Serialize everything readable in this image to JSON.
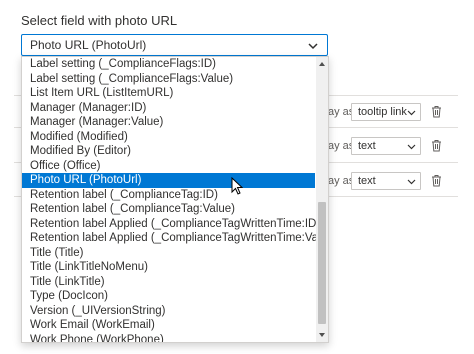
{
  "field": {
    "label": "Select field with photo URL",
    "selected_value": "Photo URL (PhotoUrl)"
  },
  "background_rows": [
    {
      "prefix": "ay as",
      "select_value": "tooltip link"
    },
    {
      "prefix": "ay as",
      "select_value": "text"
    },
    {
      "prefix": "ay as",
      "select_value": "text"
    }
  ],
  "dropdown": {
    "options": [
      "Label setting (_ComplianceFlags:ID)",
      "Label setting (_ComplianceFlags:Value)",
      "List Item URL (ListItemURL)",
      "Manager (Manager:ID)",
      "Manager (Manager:Value)",
      "Modified (Modified)",
      "Modified By (Editor)",
      "Office (Office)",
      "Photo URL (PhotoUrl)",
      "Retention label (_ComplianceTag:ID)",
      "Retention label (_ComplianceTag:Value)",
      "Retention label Applied (_ComplianceTagWrittenTime:ID)",
      "Retention label Applied (_ComplianceTagWrittenTime:Value)",
      "Title (Title)",
      "Title (LinkTitleNoMenu)",
      "Title (LinkTitle)",
      "Type (DocIcon)",
      "Version (_UIVersionString)",
      "Work Email (WorkEmail)",
      "Work Phone (WorkPhone)"
    ],
    "selected_index": 8
  },
  "colors": {
    "accent": "#0078d4",
    "selected_text": "#ffffff",
    "text": "#323130"
  },
  "icons": {
    "select_chevron": "chevron-down-icon",
    "row_delete": "trash-icon",
    "pointer": "mouse-cursor-icon"
  }
}
